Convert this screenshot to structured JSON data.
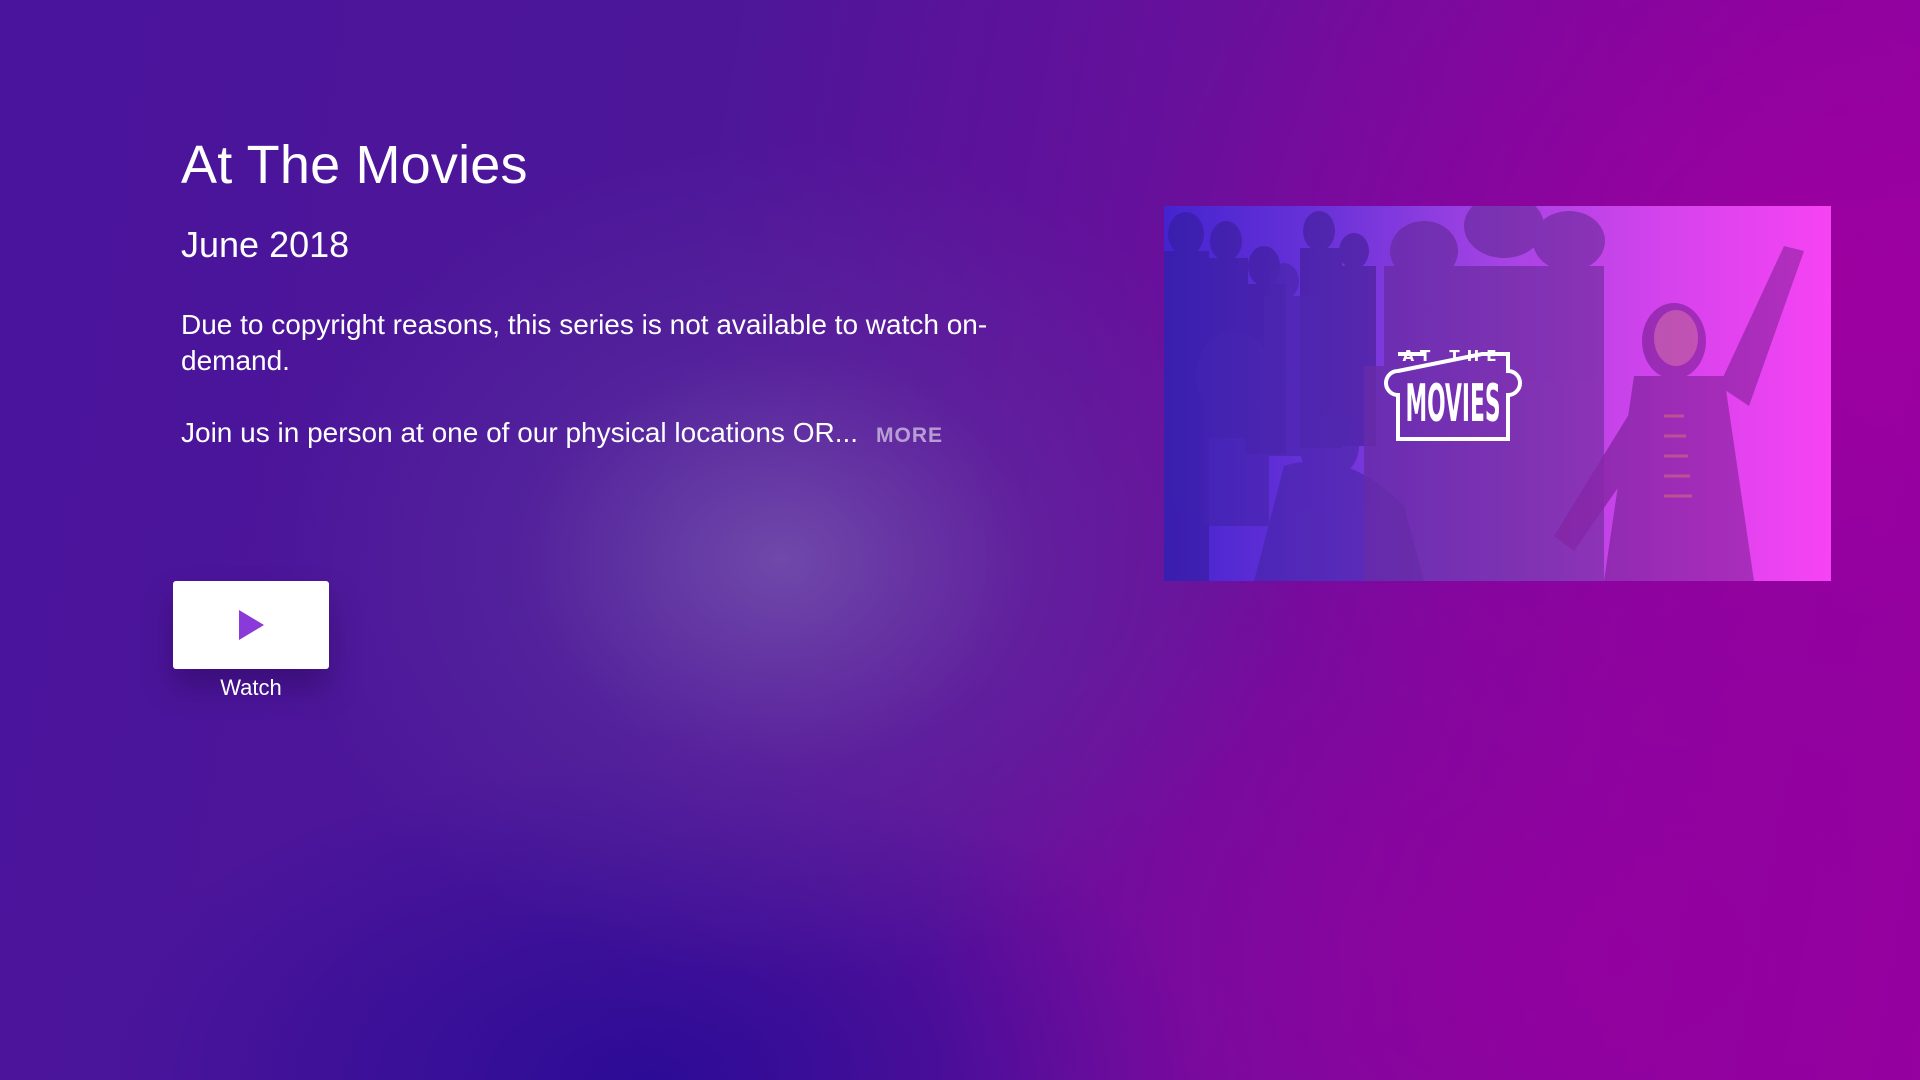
{
  "show": {
    "title": "At The Movies",
    "subtitle": "June 2018",
    "description": "Due to copyright reasons, this series is not available to watch on-demand.",
    "description_more": "Join us in person at one of our physical locations OR...",
    "more_label": "MORE"
  },
  "actions": {
    "watch_label": "Watch",
    "watch_icon": "play-icon"
  },
  "artwork": {
    "logo_line1": "AT THE",
    "logo_line2": "MOVIES"
  },
  "colors": {
    "play_icon": "#8a3ad8",
    "background_left": "#4a149c",
    "background_right": "#94009f"
  }
}
